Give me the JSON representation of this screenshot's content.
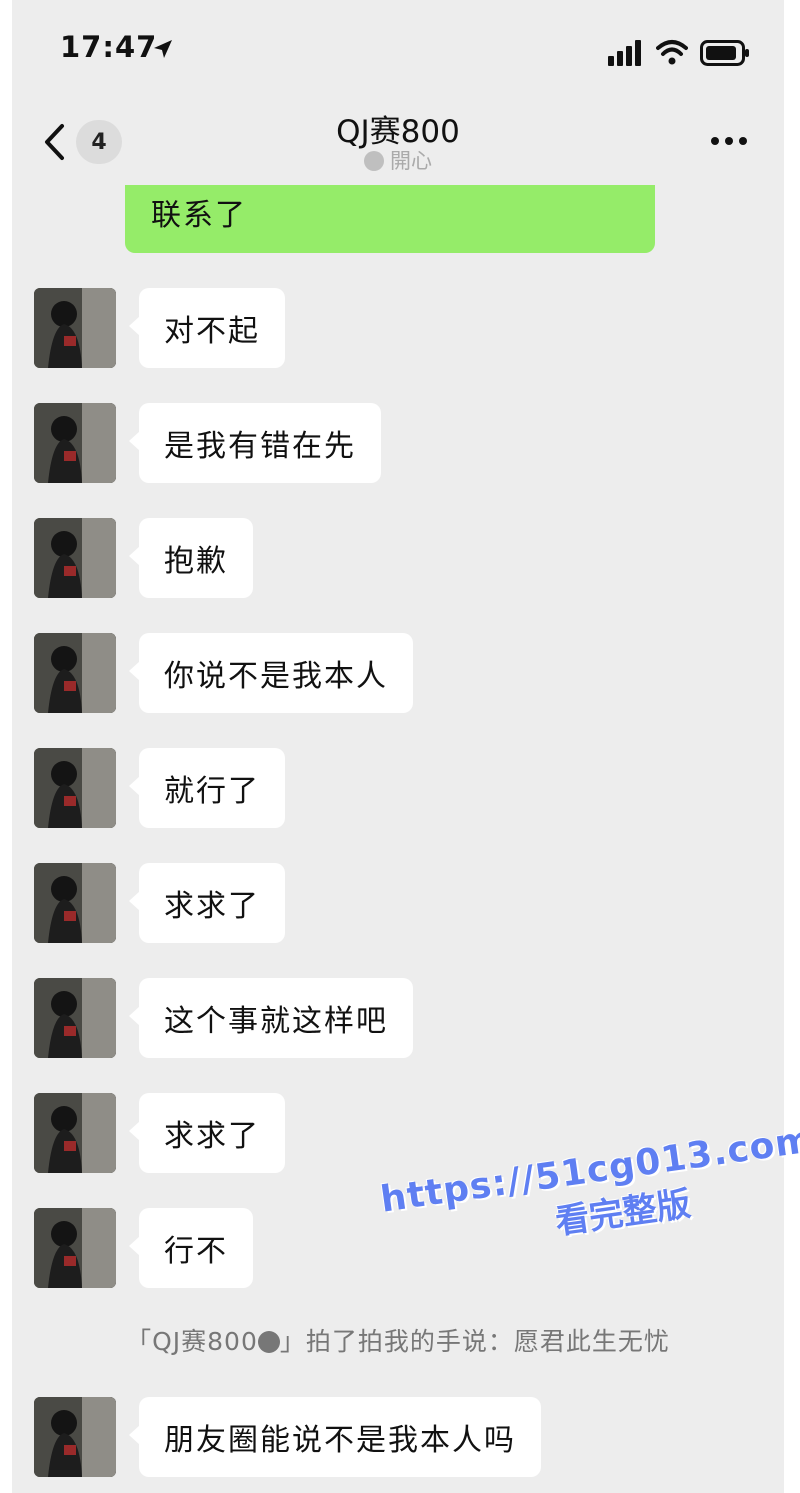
{
  "status_bar": {
    "time": "17:47",
    "icons": [
      "location-arrow-icon",
      "signal-icon",
      "wifi-icon",
      "battery-icon"
    ]
  },
  "nav": {
    "back_count": "4",
    "title": "QJ赛800",
    "subtitle": "開心"
  },
  "outgoing": {
    "text": "联系了"
  },
  "messages": [
    "对不起",
    "是我有错在先",
    "抱歉",
    "你说不是我本人",
    "就行了",
    "求求了",
    "这个事就这样吧",
    "求求了",
    "行不",
    "朋友圈能说不是我本人吗"
  ],
  "system_note": {
    "part1": "「QJ赛800",
    "part2": "」拍了拍我的手说：愿君此生无忧"
  },
  "watermark": {
    "url": "https://51cg013.com",
    "sub": "看完整版"
  },
  "colors": {
    "background": "#ededed",
    "outgoing_bubble": "#95ec69",
    "incoming_bubble": "#ffffff",
    "watermark": "#5f7ff2"
  }
}
